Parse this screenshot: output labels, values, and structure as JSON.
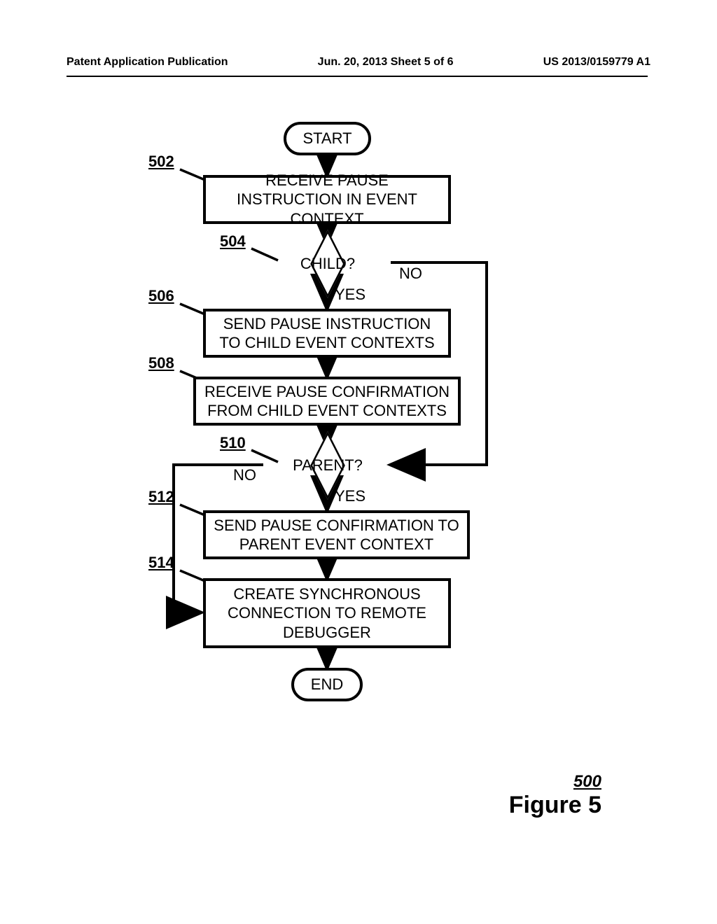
{
  "header": {
    "left": "Patent Application Publication",
    "center": "Jun. 20, 2013  Sheet 5 of 6",
    "right": "US 2013/0159779 A1"
  },
  "flowchart": {
    "start": "START",
    "end": "END",
    "refs": {
      "r502": "502",
      "r504": "504",
      "r506": "506",
      "r508": "508",
      "r510": "510",
      "r512": "512",
      "r514": "514"
    },
    "steps": {
      "s502": "RECEIVE PAUSE INSTRUCTION IN EVENT CONTEXT",
      "s504": "CHILD?",
      "s506": "SEND PAUSE INSTRUCTION TO CHILD EVENT CONTEXTS",
      "s508": "RECEIVE PAUSE CONFIRMATION FROM CHILD EVENT CONTEXTS",
      "s510": "PARENT?",
      "s512": "SEND PAUSE CONFIRMATION TO PARENT EVENT CONTEXT",
      "s514": "CREATE SYNCHRONOUS CONNECTION TO REMOTE DEBUGGER"
    },
    "labels": {
      "yes": "YES",
      "no": "NO"
    }
  },
  "figure": {
    "ref": "500",
    "title": "Figure 5"
  }
}
